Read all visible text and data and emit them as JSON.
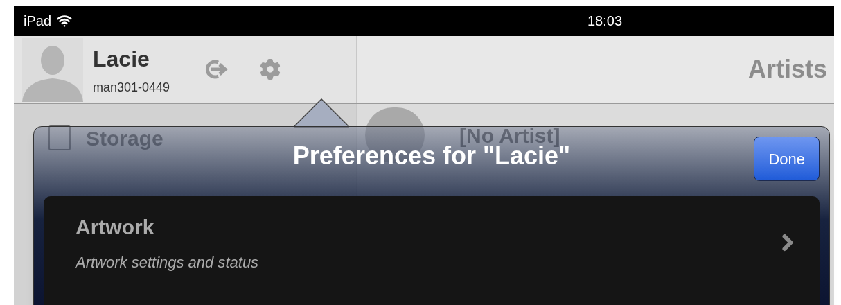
{
  "status_bar": {
    "carrier": "iPad",
    "time": "18:03"
  },
  "account": {
    "name": "Lacie",
    "id": "man301-0449"
  },
  "detail": {
    "title": "Artists"
  },
  "background_list": [
    {
      "label": "Storage"
    }
  ],
  "artists": [
    {
      "name": "[No Artist]"
    }
  ],
  "popover": {
    "title": "Preferences for \"Lacie\"",
    "done_button": "Done",
    "items": [
      {
        "title": "Artwork",
        "subtitle": "Artwork settings and status"
      }
    ]
  }
}
